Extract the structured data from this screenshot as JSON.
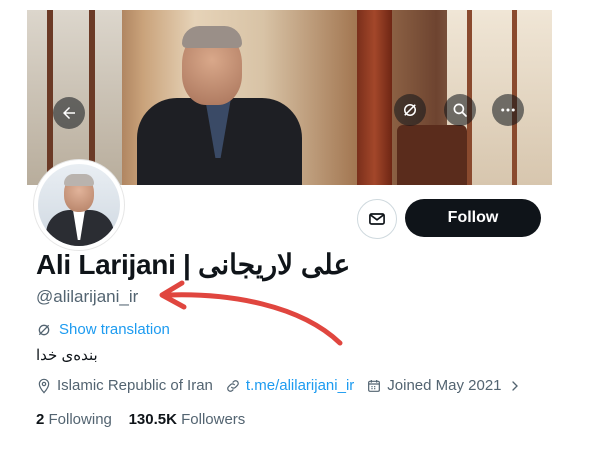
{
  "profile": {
    "name": "Ali Larijani | علی لاریجانی",
    "handle": "@alilarijani_ir",
    "show_translation": "Show translation",
    "bio": "بنده‌ی خدا",
    "location": "Islamic Republic of Iran",
    "website": "t.me/alilarijani_ir",
    "joined": "Joined May 2021",
    "following_count": "2",
    "following_label": "Following",
    "followers_count": "130.5K",
    "followers_label": "Followers"
  },
  "actions": {
    "follow_label": "Follow"
  },
  "icons": {
    "back": "arrow-left-icon",
    "translate": "translate-icon",
    "search": "search-icon",
    "more": "more-icon",
    "message": "message-icon",
    "location": "location-icon",
    "link": "link-icon",
    "calendar": "calendar-icon",
    "chevron": "chevron-right-icon"
  },
  "colors": {
    "accent": "#1d9bf0",
    "annotation_arrow": "#e0463f",
    "follow_bg": "#0f1419"
  }
}
